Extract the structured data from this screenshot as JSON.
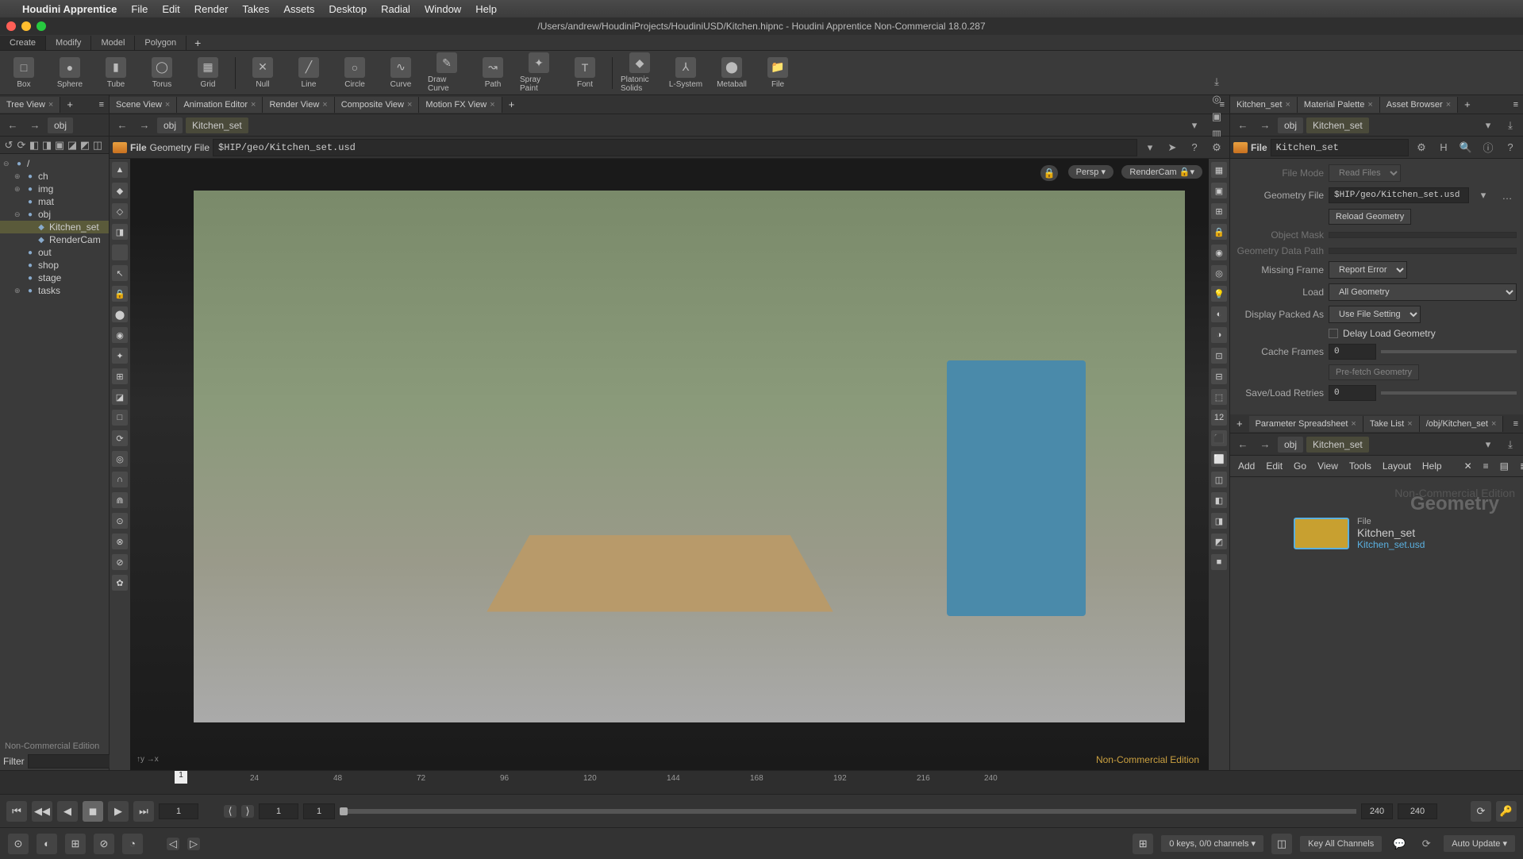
{
  "mac_menu": {
    "apple": "",
    "app": "Houdini Apprentice",
    "items": [
      "File",
      "Edit",
      "Render",
      "Takes",
      "Assets",
      "Desktop",
      "Radial",
      "Window",
      "Help"
    ]
  },
  "titlebar": "/Users/andrew/HoudiniProjects/HoudiniUSD/Kitchen.hipnc - Houdini Apprentice Non-Commercial 18.0.287",
  "shelf_tabs": [
    "Create",
    "Modify",
    "Model",
    "Polygon"
  ],
  "shelf_plus": "+",
  "shelf_tools": [
    {
      "label": "Box",
      "glyph": "□"
    },
    {
      "label": "Sphere",
      "glyph": "●"
    },
    {
      "label": "Tube",
      "glyph": "▮"
    },
    {
      "label": "Torus",
      "glyph": "◯"
    },
    {
      "label": "Grid",
      "glyph": "▦"
    },
    {
      "label": "Null",
      "glyph": "✕"
    },
    {
      "label": "Line",
      "glyph": "╱"
    },
    {
      "label": "Circle",
      "glyph": "○"
    },
    {
      "label": "Curve",
      "glyph": "∿"
    },
    {
      "label": "Draw Curve",
      "glyph": "✎"
    },
    {
      "label": "Path",
      "glyph": "↝"
    },
    {
      "label": "Spray Paint",
      "glyph": "✦"
    },
    {
      "label": "Font",
      "glyph": "T"
    },
    {
      "label": "Platonic Solids",
      "glyph": "◆"
    },
    {
      "label": "L-System",
      "glyph": "⅄"
    },
    {
      "label": "Metaball",
      "glyph": "⬤"
    },
    {
      "label": "File",
      "glyph": "📁"
    }
  ],
  "left": {
    "tab": "Tree View",
    "close": "×",
    "plus": "+",
    "menu": "≡",
    "small_icons": [
      "↺",
      "⟳",
      "◧",
      "◨",
      "▣",
      "◪",
      "◩",
      "◫"
    ],
    "path_obj": "obj",
    "tree": [
      {
        "ind": 0,
        "tog": "⊖",
        "label": "/",
        "icon": "●"
      },
      {
        "ind": 1,
        "tog": "⊕",
        "label": "ch",
        "icon": "●"
      },
      {
        "ind": 1,
        "tog": "⊕",
        "label": "img",
        "icon": "●"
      },
      {
        "ind": 1,
        "tog": "",
        "label": "mat",
        "icon": "●"
      },
      {
        "ind": 1,
        "tog": "⊖",
        "label": "obj",
        "icon": "●"
      },
      {
        "ind": 2,
        "tog": "",
        "label": "Kitchen_set",
        "icon": "◆",
        "sel": true
      },
      {
        "ind": 2,
        "tog": "",
        "label": "RenderCam",
        "icon": "◆"
      },
      {
        "ind": 1,
        "tog": "",
        "label": "out",
        "icon": "●"
      },
      {
        "ind": 1,
        "tog": "",
        "label": "shop",
        "icon": "●"
      },
      {
        "ind": 1,
        "tog": "",
        "label": "stage",
        "icon": "●"
      },
      {
        "ind": 1,
        "tog": "⊕",
        "label": "tasks",
        "icon": "●"
      }
    ],
    "nc": "Non-Commercial Edition",
    "filter_label": "Filter",
    "filter_dd": "▾"
  },
  "center": {
    "tabs": [
      "Scene View",
      "Animation Editor",
      "Render View",
      "Composite View",
      "Motion FX View"
    ],
    "tab_close": "×",
    "tab_plus": "+",
    "tab_menu": "≡",
    "back": "←",
    "fwd": "→",
    "obj": "obj",
    "node": "Kitchen_set",
    "dd": "▾",
    "right_icons": [
      "⤓",
      "◎",
      "▣",
      "▥",
      "◩",
      "■"
    ],
    "file_label": "File",
    "file_param": "Geometry File",
    "file_path": "$HIP/geo/Kitchen_set.usd",
    "file_dd": "▾",
    "file_icons": [
      "➤",
      "?",
      "⚙"
    ],
    "lock": "🔒",
    "persp": "Persp ▾",
    "rendercam": "RenderCam 🔒▾",
    "nc_water": "Non-Commercial Edition",
    "left_tools": [
      "▲",
      "◆",
      "◇",
      "◨",
      "",
      "↖",
      "🔒",
      "⬤",
      "◉",
      "✦",
      "⊞",
      "◪",
      "□",
      "⟳",
      "◎",
      "∩",
      "⋒",
      "⊙",
      "⊗",
      "⊘",
      "✿"
    ],
    "right_tools": [
      "▦",
      "▣",
      "⊞",
      "🔒",
      "◉",
      "◎",
      "💡",
      "◐",
      "◑",
      "⊡",
      "⊟",
      "⬚",
      "12",
      "⬛",
      "⬜",
      "◫",
      "◧",
      "◨",
      "◩",
      "■"
    ]
  },
  "right": {
    "tabs_top": [
      "Kitchen_set",
      "Material Palette",
      "Asset Browser"
    ],
    "tab_close": "×",
    "tab_plus": "+",
    "tab_menu": "≡",
    "back": "←",
    "fwd": "→",
    "obj": "obj",
    "node": "Kitchen_set",
    "dd": "▾",
    "pin": "⤓",
    "file_label": "File",
    "file_name": "Kitchen_set",
    "file_icons": [
      "⚙",
      "H",
      "🔍",
      "ⓘ",
      "?"
    ],
    "params": {
      "file_mode_l": "File Mode",
      "file_mode_v": "Read Files",
      "geom_file_l": "Geometry File",
      "geom_file_v": "$HIP/geo/Kitchen_set.usd",
      "reload": "Reload Geometry",
      "obj_mask_l": "Object Mask",
      "geom_data_l": "Geometry Data Path",
      "missing_l": "Missing Frame",
      "missing_v": "Report Error",
      "load_l": "Load",
      "load_v": "All Geometry",
      "packed_l": "Display Packed As",
      "packed_v": "Use File Setting",
      "delay_l": "Delay Load Geometry",
      "cache_l": "Cache Frames",
      "cache_v": "0",
      "prefetch": "Pre-fetch Geometry",
      "retry_l": "Save/Load Retries",
      "retry_v": "0"
    },
    "tabs_bot": [
      "/obj/Kitchen_set",
      "Take List",
      "Parameter Spreadsheet"
    ],
    "node_menu": [
      "Add",
      "Edit",
      "Go",
      "View",
      "Tools",
      "Layout",
      "Help"
    ],
    "node_menu_icons": [
      "✕",
      "≡",
      "▤",
      "≣"
    ],
    "node_wm": "Geometry",
    "node_wm2": "Non-Commercial Edition",
    "node_file": "File",
    "node_name": "Kitchen_set",
    "node_path": "Kitchen_set.usd"
  },
  "timeline": {
    "playhead": "1",
    "ticks": [
      {
        "p": 315,
        "v": "24"
      },
      {
        "p": 420,
        "v": "48"
      },
      {
        "p": 525,
        "v": "72"
      },
      {
        "p": 630,
        "v": "96"
      },
      {
        "p": 735,
        "v": "120"
      },
      {
        "p": 840,
        "v": "144"
      },
      {
        "p": 945,
        "v": "168"
      },
      {
        "p": 1050,
        "v": "192"
      },
      {
        "p": 1155,
        "v": "216"
      },
      {
        "p": 1240,
        "v": "240"
      }
    ],
    "first": "⏮",
    "prevkey": "◀◀",
    "prev": "◀",
    "stop": "◼",
    "play": "▶",
    "last": "⏭",
    "frame": "1",
    "start": "1",
    "end": "240",
    "end2": "240",
    "small": [
      "⟨",
      "⟩"
    ],
    "row2": [
      "⊙",
      "◐",
      "⊞",
      "⊘",
      "◔"
    ],
    "prevk2": "◁",
    "nextk2": "▷"
  },
  "status": {
    "keys": "0 keys, 0/0 channels",
    "keyall": "Key All Channels",
    "chat": "💬",
    "refresh": "⟳",
    "auto": "Auto Update",
    "dd": "▾",
    "kicon1": "⊞",
    "kicon2": "◫"
  }
}
